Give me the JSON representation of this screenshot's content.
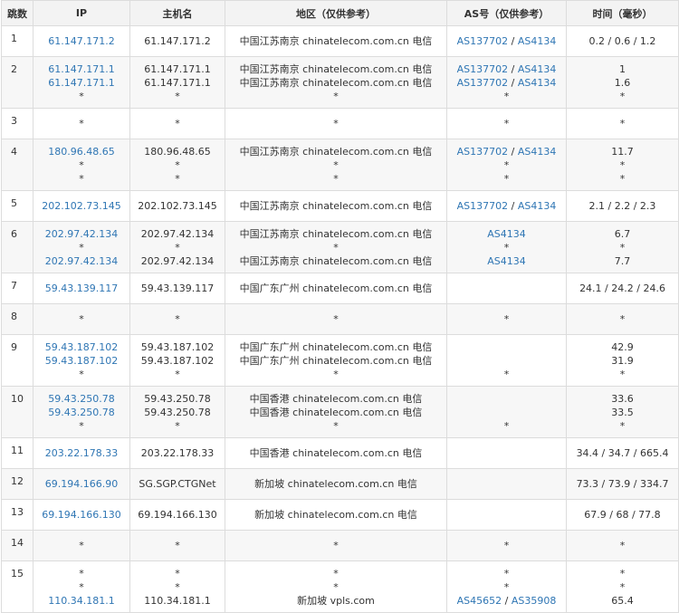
{
  "headers": {
    "hop": "跳数",
    "ip": "IP",
    "host": "主机名",
    "region": "地区（仅供参考）",
    "as": "AS号（仅供参考）",
    "time": "时间（毫秒）"
  },
  "rows": [
    {
      "hop": "1",
      "ip": [
        "61.147.171.2"
      ],
      "host": [
        "61.147.171.2"
      ],
      "region": [
        "中国江苏南京 chinatelecom.com.cn 电信"
      ],
      "as": [
        [
          "AS137702",
          "AS4134"
        ]
      ],
      "time": [
        "0.2 / 0.6 / 1.2"
      ]
    },
    {
      "hop": "2",
      "ip": [
        "61.147.171.1",
        "61.147.171.1",
        "*"
      ],
      "host": [
        "61.147.171.1",
        "61.147.171.1",
        "*"
      ],
      "region": [
        "中国江苏南京 chinatelecom.com.cn 电信",
        "中国江苏南京 chinatelecom.com.cn 电信",
        "*"
      ],
      "as": [
        [
          "AS137702",
          "AS4134"
        ],
        [
          "AS137702",
          "AS4134"
        ],
        [
          "*"
        ]
      ],
      "time": [
        "1",
        "1.6",
        "*"
      ]
    },
    {
      "hop": "3",
      "ip": [
        "*"
      ],
      "host": [
        "*"
      ],
      "region": [
        "*"
      ],
      "as": [
        [
          "*"
        ]
      ],
      "time": [
        "*"
      ]
    },
    {
      "hop": "4",
      "ip": [
        "180.96.48.65",
        "*",
        "*"
      ],
      "host": [
        "180.96.48.65",
        "*",
        "*"
      ],
      "region": [
        "中国江苏南京 chinatelecom.com.cn 电信",
        "*",
        "*"
      ],
      "as": [
        [
          "AS137702",
          "AS4134"
        ],
        [
          "*"
        ],
        [
          "*"
        ]
      ],
      "time": [
        "11.7",
        "*",
        "*"
      ]
    },
    {
      "hop": "5",
      "ip": [
        "202.102.73.145"
      ],
      "host": [
        "202.102.73.145"
      ],
      "region": [
        "中国江苏南京 chinatelecom.com.cn 电信"
      ],
      "as": [
        [
          "AS137702",
          "AS4134"
        ]
      ],
      "time": [
        "2.1 / 2.2 / 2.3"
      ]
    },
    {
      "hop": "6",
      "ip": [
        "202.97.42.134",
        "*",
        "202.97.42.134"
      ],
      "host": [
        "202.97.42.134",
        "*",
        "202.97.42.134"
      ],
      "region": [
        "中国江苏南京 chinatelecom.com.cn 电信",
        "*",
        "中国江苏南京 chinatelecom.com.cn 电信"
      ],
      "as": [
        [
          "AS4134"
        ],
        [
          "*"
        ],
        [
          "AS4134"
        ]
      ],
      "time": [
        "6.7",
        "*",
        "7.7"
      ]
    },
    {
      "hop": "7",
      "ip": [
        "59.43.139.117"
      ],
      "host": [
        "59.43.139.117"
      ],
      "region": [
        "中国广东广州 chinatelecom.com.cn 电信"
      ],
      "as": [
        []
      ],
      "time": [
        "24.1 / 24.2 / 24.6"
      ]
    },
    {
      "hop": "8",
      "ip": [
        "*"
      ],
      "host": [
        "*"
      ],
      "region": [
        "*"
      ],
      "as": [
        [
          "*"
        ]
      ],
      "time": [
        "*"
      ]
    },
    {
      "hop": "9",
      "ip": [
        "59.43.187.102",
        "59.43.187.102",
        "*"
      ],
      "host": [
        "59.43.187.102",
        "59.43.187.102",
        "*"
      ],
      "region": [
        "中国广东广州 chinatelecom.com.cn 电信",
        "中国广东广州 chinatelecom.com.cn 电信",
        "*"
      ],
      "as": [
        [],
        [],
        [
          "*"
        ]
      ],
      "time": [
        "42.9",
        "31.9",
        "*"
      ]
    },
    {
      "hop": "10",
      "ip": [
        "59.43.250.78",
        "59.43.250.78",
        "*"
      ],
      "host": [
        "59.43.250.78",
        "59.43.250.78",
        "*"
      ],
      "region": [
        "中国香港 chinatelecom.com.cn 电信",
        "中国香港 chinatelecom.com.cn 电信",
        "*"
      ],
      "as": [
        [],
        [],
        [
          "*"
        ]
      ],
      "time": [
        "33.6",
        "33.5",
        "*"
      ]
    },
    {
      "hop": "11",
      "ip": [
        "203.22.178.33"
      ],
      "host": [
        "203.22.178.33"
      ],
      "region": [
        "中国香港 chinatelecom.com.cn 电信"
      ],
      "as": [
        []
      ],
      "time": [
        "34.4 / 34.7 / 665.4"
      ]
    },
    {
      "hop": "12",
      "ip": [
        "69.194.166.90"
      ],
      "host": [
        "SG.SGP.CTGNet"
      ],
      "region": [
        "新加坡 chinatelecom.com.cn 电信"
      ],
      "as": [
        []
      ],
      "time": [
        "73.3 / 73.9 / 334.7"
      ]
    },
    {
      "hop": "13",
      "ip": [
        "69.194.166.130"
      ],
      "host": [
        "69.194.166.130"
      ],
      "region": [
        "新加坡 chinatelecom.com.cn 电信"
      ],
      "as": [
        []
      ],
      "time": [
        "67.9 / 68 / 77.8"
      ]
    },
    {
      "hop": "14",
      "ip": [
        "*"
      ],
      "host": [
        "*"
      ],
      "region": [
        "*"
      ],
      "as": [
        [
          "*"
        ]
      ],
      "time": [
        "*"
      ]
    },
    {
      "hop": "15",
      "ip": [
        "*",
        "*",
        "110.34.181.1"
      ],
      "host": [
        "*",
        "*",
        "110.34.181.1"
      ],
      "region": [
        "*",
        "*",
        "新加坡 vpls.com"
      ],
      "as": [
        [
          "*"
        ],
        [
          "*"
        ],
        [
          "AS45652",
          "AS35908"
        ]
      ],
      "time": [
        "*",
        "*",
        "65.4"
      ]
    }
  ]
}
